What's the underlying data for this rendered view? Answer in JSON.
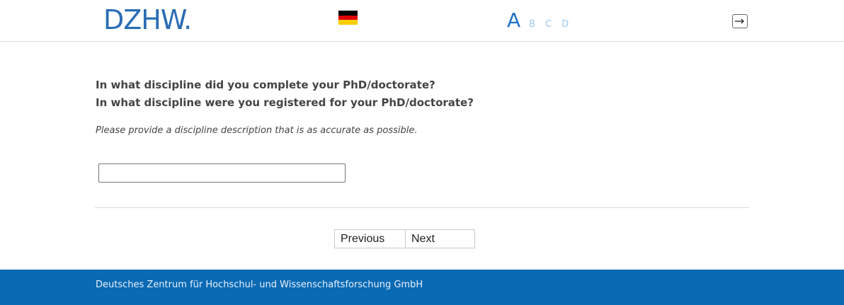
{
  "header": {
    "logo_text": "DZHW.",
    "language_flag": "german-flag-icon",
    "flag_colors": [
      "#000000",
      "#dd0000",
      "#ffce00"
    ],
    "font_sizes": {
      "large": "A",
      "options": [
        "B",
        "C",
        "D"
      ]
    },
    "logout_icon": "logout-icon"
  },
  "main": {
    "question_line1": "In what discipline did you complete your PhD/doctorate?",
    "question_line2": "In what discipline were you registered for your PhD/doctorate?",
    "instruction": "Please provide a discipline description that is as accurate as possible.",
    "answer_value": "",
    "answer_placeholder": ""
  },
  "navigation": {
    "previous_label": "Previous",
    "next_label": "Next"
  },
  "footer": {
    "text": "Deutsches Zentrum für Hochschul- und Wissenschaftsforschung GmbH"
  },
  "colors": {
    "brand_blue": "#2a6db5",
    "footer_blue": "#0a6ab4",
    "font_size_active": "#1f74c8",
    "font_size_inactive": "#9cc6ec"
  }
}
